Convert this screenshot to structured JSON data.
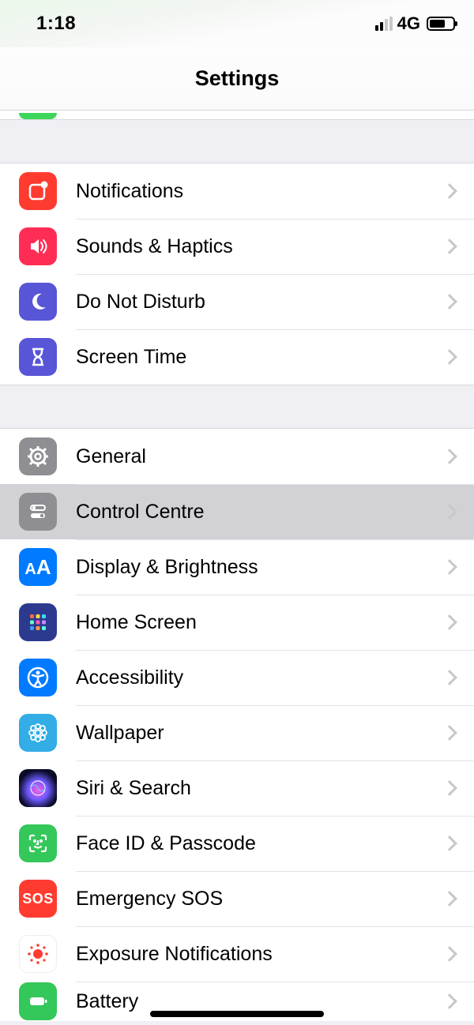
{
  "status": {
    "time": "1:18",
    "network": "4G"
  },
  "header": {
    "title": "Settings"
  },
  "groups": [
    {
      "id": "g1",
      "items": [
        {
          "id": "notifications",
          "label": "Notifications",
          "icon": "notifications-icon",
          "icon_bg": "ic-red"
        },
        {
          "id": "sounds-haptics",
          "label": "Sounds & Haptics",
          "icon": "speaker-icon",
          "icon_bg": "ic-pink"
        },
        {
          "id": "do-not-disturb",
          "label": "Do Not Disturb",
          "icon": "moon-icon",
          "icon_bg": "ic-purple"
        },
        {
          "id": "screen-time",
          "label": "Screen Time",
          "icon": "hourglass-icon",
          "icon_bg": "ic-purple"
        }
      ]
    },
    {
      "id": "g2",
      "items": [
        {
          "id": "general",
          "label": "General",
          "icon": "gear-icon",
          "icon_bg": "ic-gray"
        },
        {
          "id": "control-centre",
          "label": "Control Centre",
          "icon": "toggles-icon",
          "icon_bg": "ic-gray",
          "selected": true
        },
        {
          "id": "display-brightness",
          "label": "Display & Brightness",
          "icon": "aa-icon",
          "icon_bg": "ic-blue"
        },
        {
          "id": "home-screen",
          "label": "Home Screen",
          "icon": "grid-icon",
          "icon_bg": "ic-blue"
        },
        {
          "id": "accessibility",
          "label": "Accessibility",
          "icon": "accessibility-icon",
          "icon_bg": "ic-blue"
        },
        {
          "id": "wallpaper",
          "label": "Wallpaper",
          "icon": "flower-icon",
          "icon_bg": "ic-teal"
        },
        {
          "id": "siri-search",
          "label": "Siri & Search",
          "icon": "siri-icon",
          "icon_bg": "ic-siri"
        },
        {
          "id": "face-id-passcode",
          "label": "Face ID & Passcode",
          "icon": "faceid-icon",
          "icon_bg": "ic-green"
        },
        {
          "id": "emergency-sos",
          "label": "Emergency SOS",
          "icon": "sos-icon",
          "icon_bg": "ic-sos"
        },
        {
          "id": "exposure-notif",
          "label": "Exposure Notifications",
          "icon": "exposure-icon",
          "icon_bg": "ic-white"
        },
        {
          "id": "battery",
          "label": "Battery",
          "icon": "battery-icon",
          "icon_bg": "ic-green"
        }
      ]
    }
  ]
}
